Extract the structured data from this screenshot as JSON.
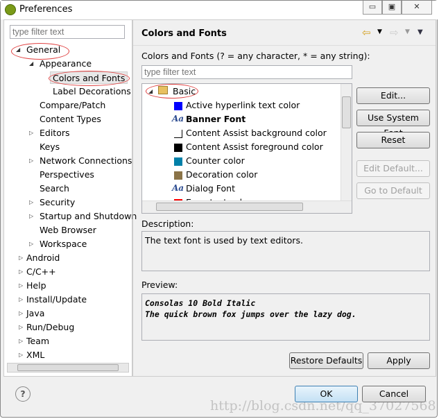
{
  "window": {
    "title": "Preferences",
    "controls": [
      "▭",
      "▣",
      "✕"
    ]
  },
  "left": {
    "filter_placeholder": "type filter text",
    "tree": [
      {
        "label": "General",
        "level": 0,
        "expanded": true
      },
      {
        "label": "Appearance",
        "level": 1,
        "expanded": true
      },
      {
        "label": "Colors and Fonts",
        "level": 2,
        "selected": true
      },
      {
        "label": "Label Decorations",
        "level": 2
      },
      {
        "label": "Compare/Patch",
        "level": 1
      },
      {
        "label": "Content Types",
        "level": 1
      },
      {
        "label": "Editors",
        "level": 1,
        "expandable": true
      },
      {
        "label": "Keys",
        "level": 1
      },
      {
        "label": "Network Connections",
        "level": 1,
        "expandable": true
      },
      {
        "label": "Perspectives",
        "level": 1
      },
      {
        "label": "Search",
        "level": 1
      },
      {
        "label": "Security",
        "level": 1,
        "expandable": true
      },
      {
        "label": "Startup and Shutdown",
        "level": 1,
        "expandable": true
      },
      {
        "label": "Web Browser",
        "level": 1
      },
      {
        "label": "Workspace",
        "level": 1,
        "expandable": true
      },
      {
        "label": "Android",
        "level": 0,
        "expandable": true
      },
      {
        "label": "C/C++",
        "level": 0,
        "expandable": true
      },
      {
        "label": "Help",
        "level": 0,
        "expandable": true
      },
      {
        "label": "Install/Update",
        "level": 0,
        "expandable": true
      },
      {
        "label": "Java",
        "level": 0,
        "expandable": true
      },
      {
        "label": "Run/Debug",
        "level": 0,
        "expandable": true
      },
      {
        "label": "Team",
        "level": 0,
        "expandable": true
      },
      {
        "label": "XML",
        "level": 0,
        "expandable": true
      }
    ]
  },
  "right": {
    "title": "Colors and Fonts",
    "instructions": "Colors and Fonts (? = any character, * = any string):",
    "filter_placeholder": "type filter text",
    "category": "Basic",
    "items": [
      {
        "label": "Active hyperlink text color",
        "type": "color",
        "color": "#0000ff"
      },
      {
        "label": "Banner Font",
        "type": "font",
        "bold": true
      },
      {
        "label": "Content Assist background color",
        "type": "color",
        "color": "#ffffff"
      },
      {
        "label": "Content Assist foreground color",
        "type": "color",
        "color": "#000000"
      },
      {
        "label": "Counter color",
        "type": "color",
        "color": "#0080a8"
      },
      {
        "label": "Decoration color",
        "type": "color",
        "color": "#8b7448"
      },
      {
        "label": "Dialog Font",
        "type": "font"
      },
      {
        "label": "Error text color",
        "type": "color",
        "color": "#ff0000"
      }
    ],
    "buttons": {
      "edit": "Edit...",
      "use_system_font": "Use System Font",
      "reset": "Reset",
      "edit_default": "Edit Default...",
      "go_to_default": "Go to Default"
    },
    "description_label": "Description:",
    "description": "The text font is used by text editors.",
    "preview_label": "Preview:",
    "preview_lines": [
      "Consolas 10 Bold Italic",
      "The quick brown fox jumps over the lazy dog."
    ],
    "restore_defaults": "Restore Defaults",
    "apply": "Apply"
  },
  "footer": {
    "help": "?",
    "ok": "OK",
    "cancel": "Cancel",
    "watermark": "http://blog.csdn.net/qq_37027568"
  }
}
